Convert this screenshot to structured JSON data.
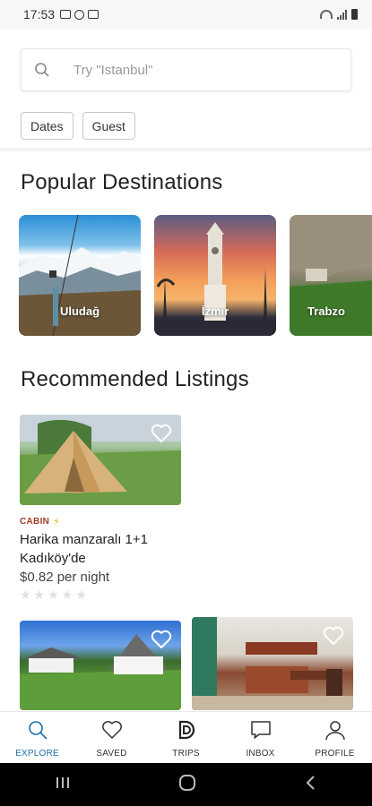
{
  "status_bar": {
    "time": "17:53"
  },
  "search": {
    "placeholder": "Try \"Istanbul\""
  },
  "filters": [
    {
      "label": "Dates"
    },
    {
      "label": "Guest"
    }
  ],
  "popular": {
    "title": "Popular Destinations",
    "items": [
      {
        "label": "Uludağ"
      },
      {
        "label": "İzmir"
      },
      {
        "label": "Trabzo"
      }
    ]
  },
  "recommended": {
    "title": "Recommended Listings",
    "listings": [
      {
        "tag": "CABIN",
        "title": "Harika manzaralı 1+1 Kadıköy'de",
        "price": "$0.82 per night",
        "rating_stars": 0,
        "max_stars": 5
      }
    ]
  },
  "nav": {
    "items": [
      {
        "label": "EXPLORE",
        "icon": "search-icon"
      },
      {
        "label": "SAVED",
        "icon": "heart-icon"
      },
      {
        "label": "TRIPS",
        "icon": "trips-icon"
      },
      {
        "label": "INBOX",
        "icon": "chat-icon"
      },
      {
        "label": "PROFILE",
        "icon": "user-icon"
      }
    ],
    "active_color": "#1e6fa8"
  },
  "colors": {
    "tag": "#a23a2b",
    "bolt": "#f1b400"
  }
}
